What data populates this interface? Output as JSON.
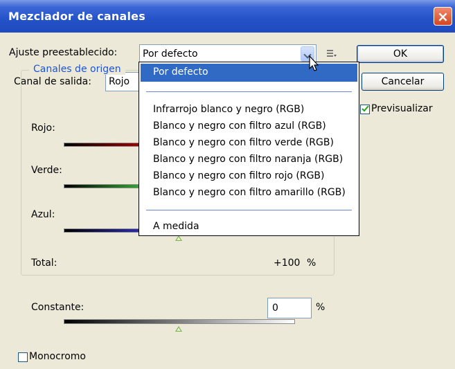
{
  "window": {
    "title": "Mezclador de canales"
  },
  "preset": {
    "label": "Ajuste preestablecido:",
    "value": "Por defecto"
  },
  "output_channel": {
    "label": "Canal de salida:",
    "value": "Rojo"
  },
  "buttons": {
    "ok": "OK",
    "cancel": "Cancelar"
  },
  "preview": {
    "label": "Previsualizar",
    "checked": true
  },
  "source_channels": {
    "legend": "Canales de origen",
    "red_label": "Rojo:",
    "green_label": "Verde:",
    "blue_label": "Azul:",
    "total_label": "Total:",
    "total_value": "+100",
    "total_unit": "%"
  },
  "constant": {
    "label": "Constante:",
    "value": "0",
    "unit": "%"
  },
  "monochrome": {
    "label": "Monocromo",
    "checked": false
  },
  "dropdown": {
    "selected": "Por defecto",
    "items": [
      "Infrarrojo blanco y negro (RGB)",
      "Blanco y negro con filtro azul (RGB)",
      "Blanco y negro con filtro verde (RGB)",
      "Blanco y negro con filtro naranja (RGB)",
      "Blanco y negro con filtro rojo (RGB)",
      "Blanco y negro con filtro amarillo (RGB)"
    ],
    "custom": "A medida"
  },
  "icons": [
    "close-icon",
    "chevron-down-icon",
    "preset-menu-icon",
    "mouse-cursor-icon",
    "checkmark-icon"
  ],
  "colors": {
    "title_bar": "#2452c7",
    "accent_blue": "#316ac5",
    "legend_text": "#1a54d8",
    "close_button": "#d4461f",
    "slider_thumb": "#7bb24a"
  }
}
